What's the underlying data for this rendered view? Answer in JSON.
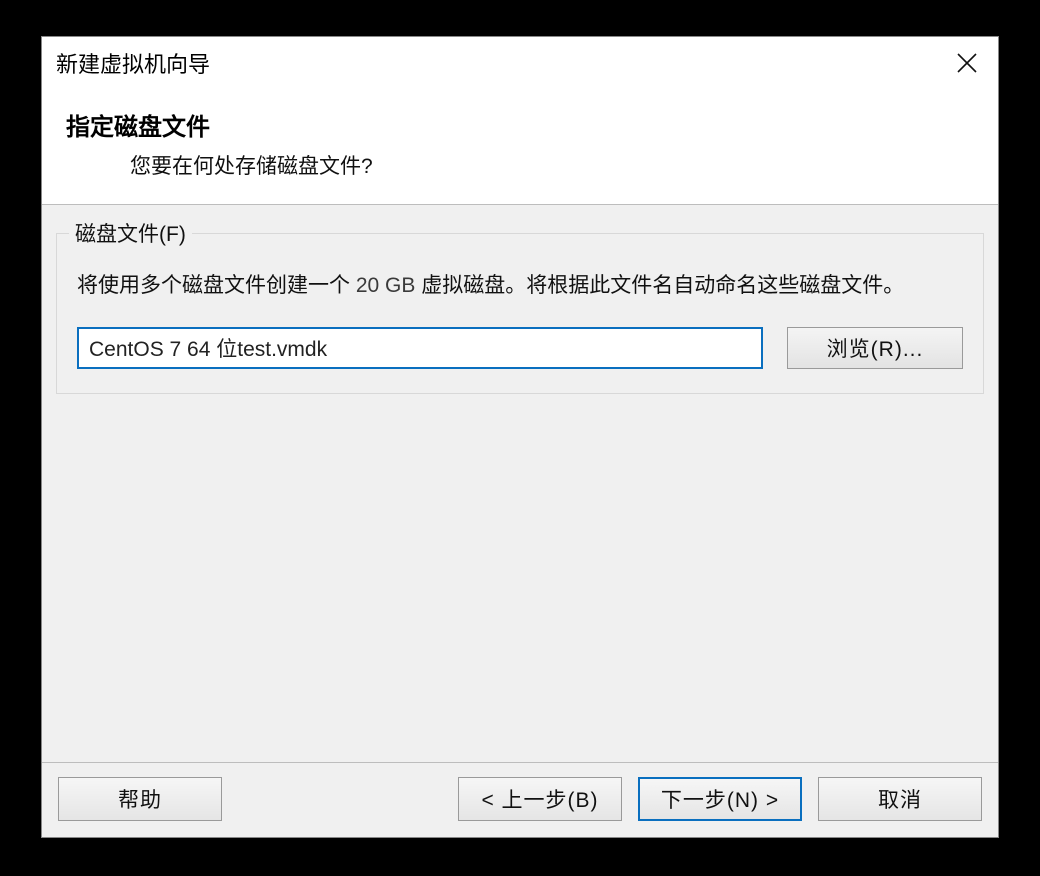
{
  "titlebar": {
    "title": "新建虚拟机向导"
  },
  "header": {
    "heading": "指定磁盘文件",
    "subtitle": "您要在何处存储磁盘文件?"
  },
  "fieldset": {
    "legend": "磁盘文件(F)",
    "desc_before": "将使用多个磁盘文件创建一个 ",
    "size_text": "20 GB",
    "desc_after": " 虚拟磁盘。将根据此文件名自动命名这些磁盘文件。",
    "file_value": "CentOS 7 64 位test.vmdk",
    "browse_label": "浏览(R)..."
  },
  "footer": {
    "help": "帮助",
    "back": "< 上一步(B)",
    "next": "下一步(N) >",
    "cancel": "取消"
  }
}
